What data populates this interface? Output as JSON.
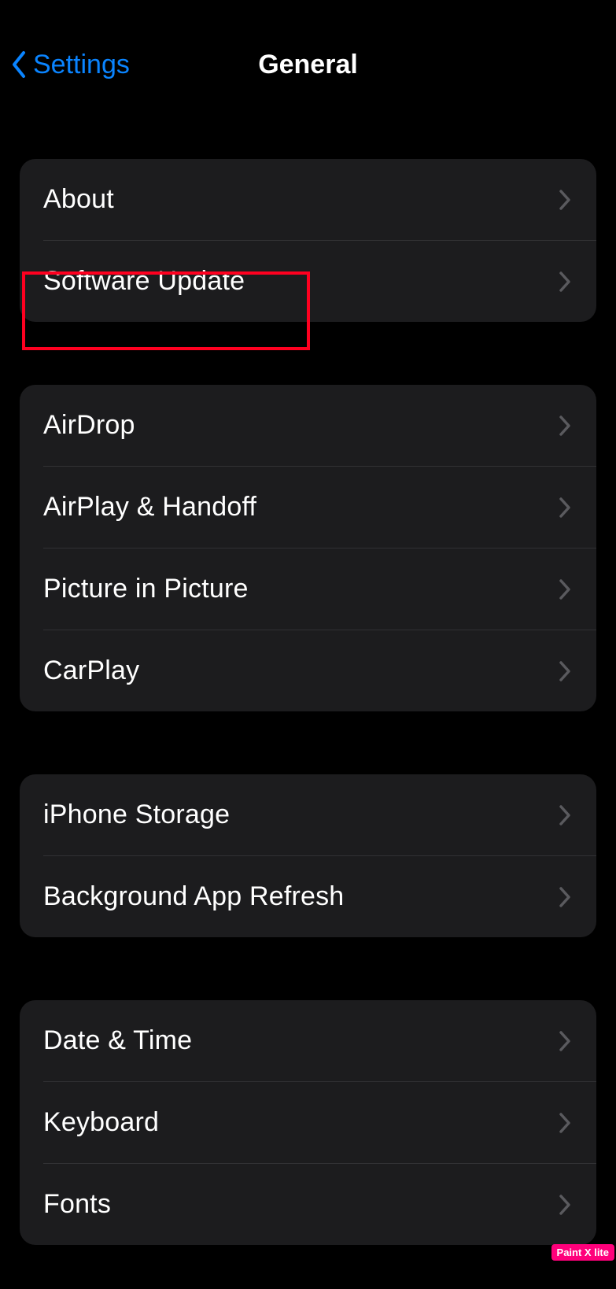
{
  "nav": {
    "back_label": "Settings",
    "title": "General"
  },
  "groups": [
    {
      "items": [
        {
          "key": "about",
          "label": "About"
        },
        {
          "key": "software-update",
          "label": "Software Update"
        }
      ]
    },
    {
      "items": [
        {
          "key": "airdrop",
          "label": "AirDrop"
        },
        {
          "key": "airplay-handoff",
          "label": "AirPlay & Handoff"
        },
        {
          "key": "picture-in-picture",
          "label": "Picture in Picture"
        },
        {
          "key": "carplay",
          "label": "CarPlay"
        }
      ]
    },
    {
      "items": [
        {
          "key": "iphone-storage",
          "label": "iPhone Storage"
        },
        {
          "key": "background-app-refresh",
          "label": "Background App Refresh"
        }
      ]
    },
    {
      "items": [
        {
          "key": "date-time",
          "label": "Date & Time"
        },
        {
          "key": "keyboard",
          "label": "Keyboard"
        },
        {
          "key": "fonts",
          "label": "Fonts"
        }
      ]
    }
  ],
  "annotation": {
    "highlight_row_key": "software-update",
    "watermark": "Paint X lite"
  },
  "colors": {
    "accent": "#0a84ff",
    "highlight": "#ff0020"
  }
}
